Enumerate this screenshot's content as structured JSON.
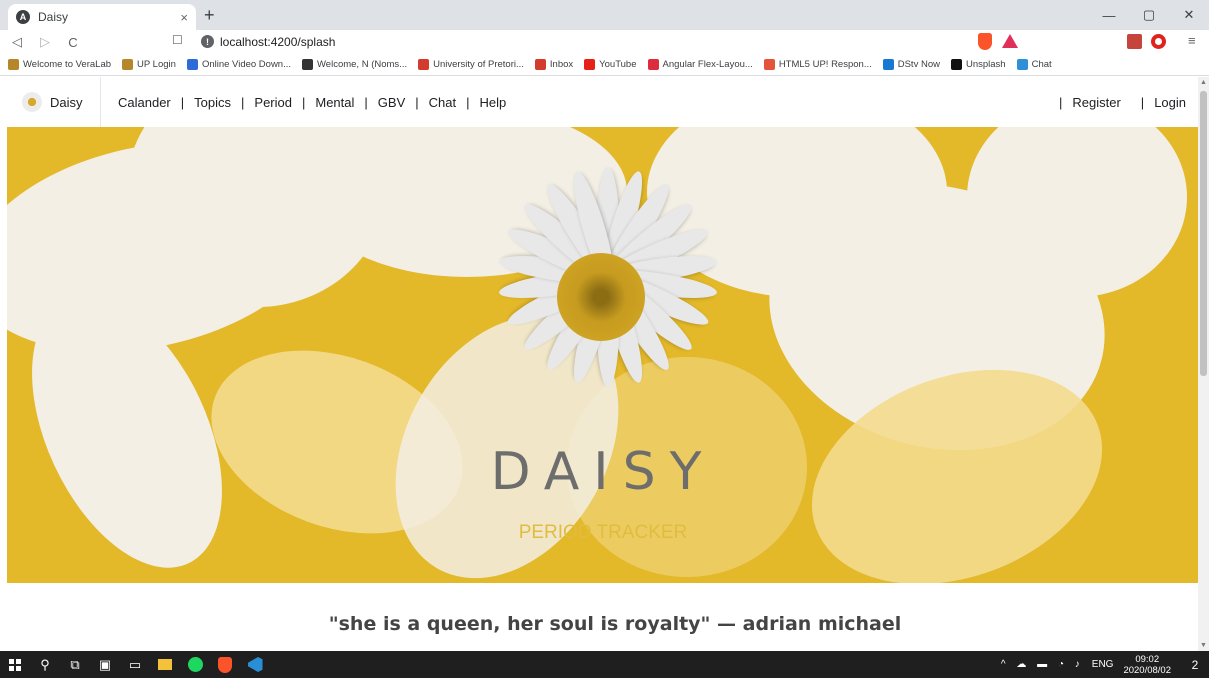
{
  "browser": {
    "tab_title": "Daisy",
    "tab_close": "×",
    "new_tab": "+",
    "url": "localhost:4200/splash",
    "window": {
      "minimize": "—",
      "maximize": "▢",
      "close": "✕"
    },
    "nav": {
      "back": "◁",
      "forward": "▷",
      "reload": "C"
    },
    "bookmarks": [
      {
        "label": "Welcome to VeraLab",
        "color": "#b5862a"
      },
      {
        "label": "UP Login",
        "color": "#b5862a"
      },
      {
        "label": "Online Video Down...",
        "color": "#2d6bd9"
      },
      {
        "label": "Welcome, N (Noms...",
        "color": "#333333"
      },
      {
        "label": "University of Pretori...",
        "color": "#d33b2c"
      },
      {
        "label": "Inbox",
        "color": "#d33b2c"
      },
      {
        "label": "YouTube",
        "color": "#e62117"
      },
      {
        "label": "Angular Flex-Layou...",
        "color": "#dd2c3d"
      },
      {
        "label": "HTML5 UP! Respon...",
        "color": "#e5533c"
      },
      {
        "label": "DStv Now",
        "color": "#1778d4"
      },
      {
        "label": "Unsplash",
        "color": "#111111"
      },
      {
        "label": "Chat",
        "color": "#2f8fd8"
      }
    ]
  },
  "site": {
    "brand": "Daisy",
    "nav_items": [
      "Calander",
      "Topics",
      "Period",
      "Mental",
      "GBV",
      "Chat",
      "Help"
    ],
    "separator": "|",
    "register": "Register",
    "login": "Login",
    "hero_title": "DAISY",
    "hero_subtitle": "PERIOD TRACKER",
    "quote": "\"she is a queen, her soul is royalty\" — adrian michael"
  },
  "taskbar": {
    "tray_lang": "ENG",
    "time": "09:02",
    "date": "2020/08/02",
    "notifications": "2"
  },
  "colors": {
    "hero_bg": "#e3b829",
    "petal": "#eeeeee",
    "subtitle": "#e0bd3e",
    "title": "#6d6d6d"
  }
}
